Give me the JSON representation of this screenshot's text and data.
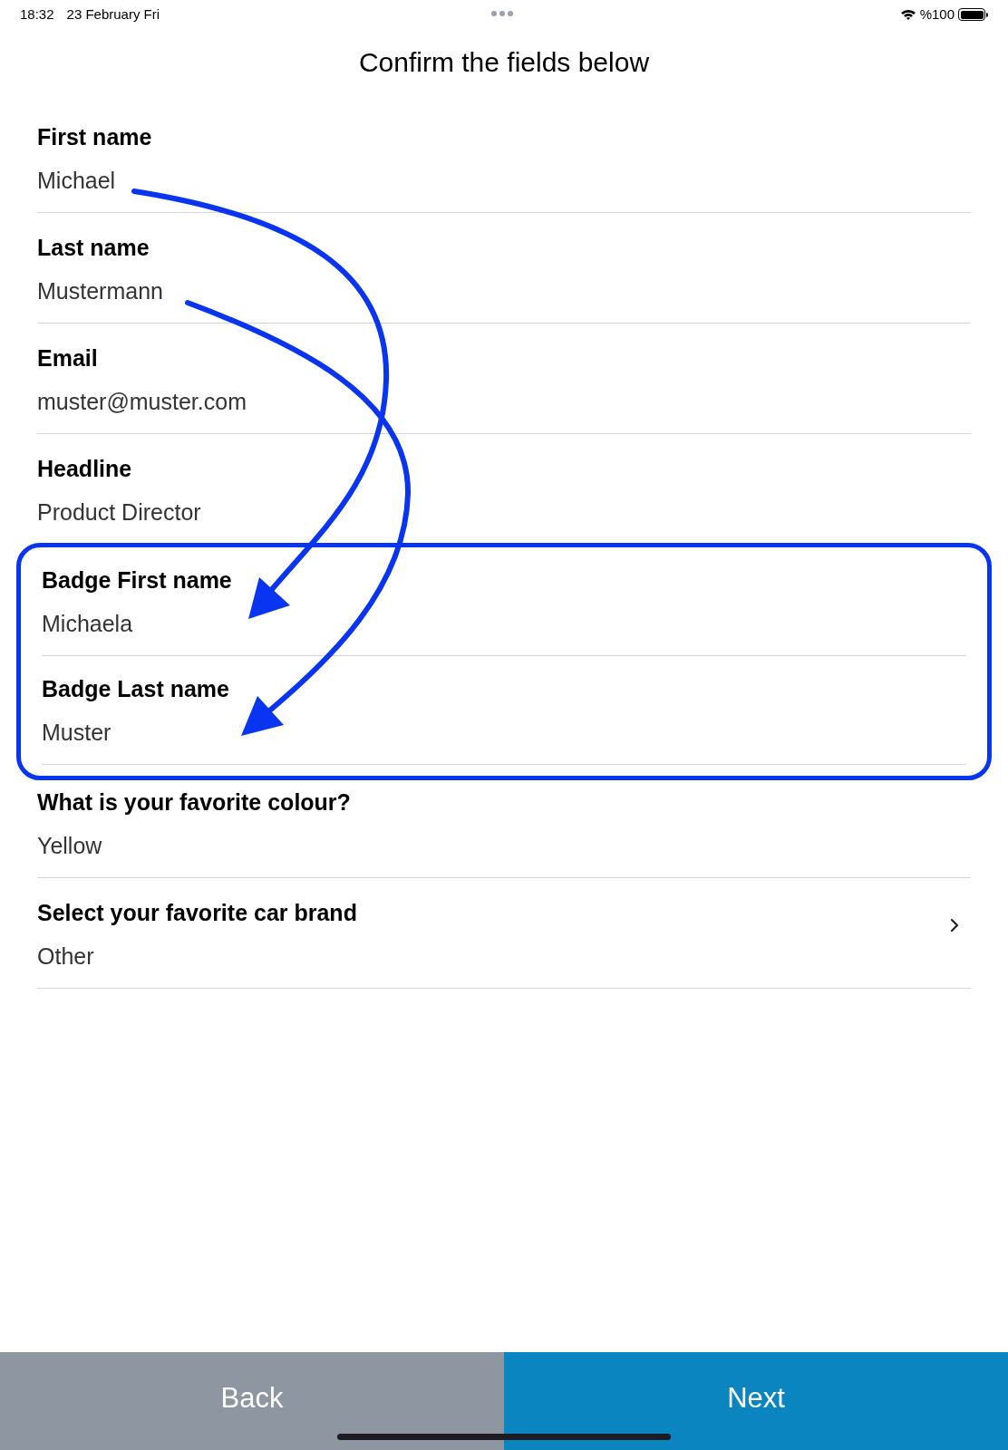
{
  "status_bar": {
    "time": "18:32",
    "date": "23 February Fri",
    "battery": "%100"
  },
  "title": "Confirm the fields below",
  "fields": [
    {
      "label": "First name",
      "value": "Michael",
      "kind": "text",
      "highlighted": false
    },
    {
      "label": "Last name",
      "value": "Mustermann",
      "kind": "text",
      "highlighted": false
    },
    {
      "label": "Email",
      "value": "muster@muster.com",
      "kind": "text",
      "highlighted": false
    },
    {
      "label": "Headline",
      "value": "Product Director",
      "kind": "text",
      "highlighted": false
    },
    {
      "label": "Badge First name",
      "value": "Michaela",
      "kind": "text",
      "highlighted": true
    },
    {
      "label": "Badge Last name",
      "value": "Muster",
      "kind": "text",
      "highlighted": true
    },
    {
      "label": "What is your favorite colour?",
      "value": "Yellow",
      "kind": "text",
      "highlighted": false
    },
    {
      "label": "Select your favorite car brand",
      "value": "Other",
      "kind": "select",
      "highlighted": false
    }
  ],
  "buttons": {
    "back": "Back",
    "next": "Next"
  }
}
